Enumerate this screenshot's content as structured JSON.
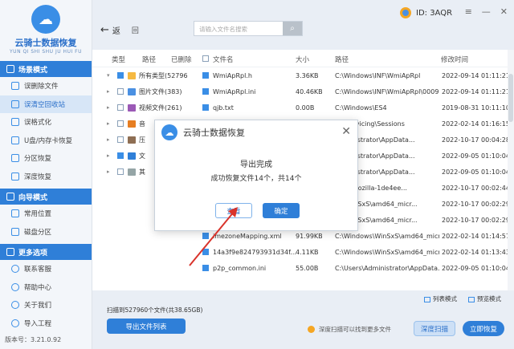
{
  "app": {
    "title": "云骑士数据恢复",
    "subtitle": "YUN QI SHI SHU JU HUI FU",
    "version": "版本号：3.21.0.92"
  },
  "sidebar": {
    "sections": [
      {
        "title": "场景模式",
        "items": [
          "误删除文件",
          "误清空回收站",
          "误格式化",
          "U盘/内存卡恢复",
          "分区恢复",
          "深度恢复"
        ]
      },
      {
        "title": "向导模式",
        "items": [
          "常用位置",
          "磁盘分区"
        ]
      },
      {
        "title": "更多选项",
        "items": [
          "联系客服",
          "帮助中心",
          "关于我们",
          "导入工程"
        ]
      }
    ],
    "active_item": "误清空回收站"
  },
  "topbar": {
    "user_id": "ID: 3AQR",
    "back_label": "返",
    "home_label": "回",
    "search_placeholder": "请输入文件名搜索"
  },
  "tree_headers": {
    "type": "类型",
    "path": "路径",
    "deleted": "已删除"
  },
  "list_headers": {
    "name": "文件名",
    "size": "大小",
    "path": "路径",
    "date": "修改时间"
  },
  "tree": [
    {
      "label": "所有类型(52796",
      "checked": true,
      "color": "#f5b942",
      "toggle": "▾"
    },
    {
      "label": "图片文件(383)",
      "checked": false,
      "color": "#4a90e2",
      "toggle": "▸"
    },
    {
      "label": "视频文件(261)",
      "checked": false,
      "color": "#9b59b6",
      "toggle": "▸"
    },
    {
      "label": "音",
      "checked": false,
      "color": "#e67e22",
      "toggle": "▸"
    },
    {
      "label": "压",
      "checked": false,
      "color": "#8e6e53",
      "toggle": "▸"
    },
    {
      "label": "文",
      "checked": true,
      "color": "#2f7fd8",
      "toggle": "▸"
    },
    {
      "label": "其",
      "checked": false,
      "color": "#95a5a6",
      "toggle": "▸"
    }
  ],
  "files": [
    {
      "name": "WmiApRpl.h",
      "size": "3.36KB",
      "path": "C:\\Windows\\INF\\WmiApRpl",
      "date": "2022-09-14 01:11:21"
    },
    {
      "name": "WmiApRpl.ini",
      "size": "40.46KB",
      "path": "C:\\Windows\\INF\\WmiApRpl\\0009",
      "date": "2022-09-14 01:11:21"
    },
    {
      "name": "qjb.txt",
      "size": "0.00B",
      "path": "C:\\Windows\\ES4",
      "date": "2019-08-31 10:11:10"
    },
    {
      "name": "",
      "size": "",
      "path": "ws\\servicing\\Sessions",
      "date": "2022-02-14 01:16:15"
    },
    {
      "name": "",
      "size": "",
      "path": "Administrator\\AppData...",
      "date": "2022-10-17 00:04:28"
    },
    {
      "name": "",
      "size": "",
      "path": "Administrator\\AppData...",
      "date": "2022-09-05 01:10:04"
    },
    {
      "name": "",
      "size": "",
      "path": "Administrator\\AppData...",
      "date": "2022-09-05 01:10:04"
    },
    {
      "name": "",
      "size": "",
      "path": "Data\\Mozilla-1de4ee...",
      "date": "2022-10-17 00:02:44"
    },
    {
      "name": "",
      "size": "",
      "path": "ws\\WinSxS\\amd64_micr...",
      "date": "2022-10-17 00:02:29"
    },
    {
      "name": "",
      "size": "",
      "path": "ws\\WinSxS\\amd64_micr...",
      "date": "2022-10-17 00:02:29"
    },
    {
      "name": "imezoneMapping.xml",
      "size": "91.99KB",
      "path": "C:\\Windows\\WinSxS\\amd64_micr...",
      "date": "2022-02-14 01:14:57"
    },
    {
      "name": "14a3f9e824793931d34f...",
      "size": "4.11KB",
      "path": "C:\\Windows\\WinSxS\\amd64_micr...",
      "date": "2022-02-14 01:13:43"
    },
    {
      "name": "p2p_common.ini",
      "size": "55.00B",
      "path": "C:\\Users\\Administrator\\AppData...",
      "date": "2022-09-05 01:10:04"
    }
  ],
  "footer": {
    "scan_info": "扫描到527960个文件(共38.65GB)",
    "export_label": "导出文件列表",
    "list_mode": "列表模式",
    "preview_mode": "预览模式",
    "deep_hint": "深度扫描可以找到更多文件",
    "deep_scan_label": "深度扫描",
    "recover_label": "立即恢复"
  },
  "modal": {
    "title": "云骑士数据恢复",
    "message": "导出完成",
    "detail": "成功恢复文件14个，共14个",
    "view_label": "查看",
    "ok_label": "确定"
  },
  "colors": {
    "accent": "#2f7fd8",
    "arrow": "#d9332b"
  }
}
